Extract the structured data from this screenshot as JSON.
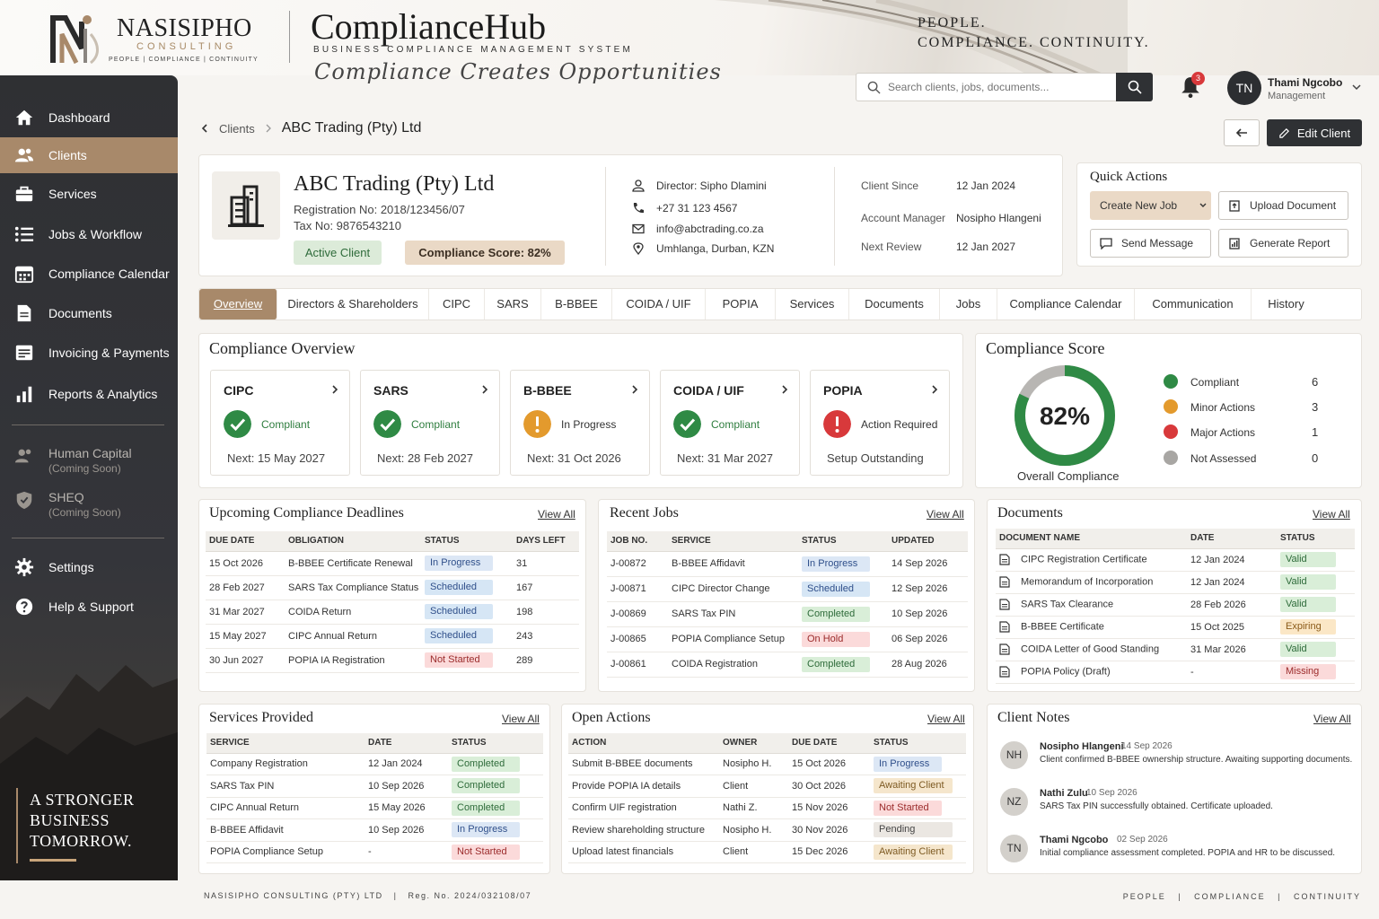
{
  "brand": {
    "name": "NASISIPHO",
    "sub": "CONSULTING",
    "tag": "PEOPLE | COMPLIANCE | CONTINUITY",
    "app_title": "ComplianceHub",
    "app_sub": "BUSINESS COMPLIANCE MANAGEMENT SYSTEM",
    "app_script": "Compliance Creates Opportunities",
    "tagline_1": "PEOPLE.",
    "tagline_2": "COMPLIANCE.  CONTINUITY."
  },
  "search": {
    "placeholder": "Search clients, jobs, documents..."
  },
  "notifications": {
    "count": "3"
  },
  "user": {
    "initials": "TN",
    "name": "Thami Ngcobo",
    "role": "Management"
  },
  "sidebar": {
    "items": [
      {
        "label": "Dashboard",
        "icon": "home-icon"
      },
      {
        "label": "Clients",
        "icon": "users-icon"
      },
      {
        "label": "Services",
        "icon": "briefcase-icon"
      },
      {
        "label": "Jobs & Workflow",
        "icon": "list-icon"
      },
      {
        "label": "Compliance Calendar",
        "icon": "calendar-icon"
      },
      {
        "label": "Documents",
        "icon": "document-icon"
      },
      {
        "label": "Invoicing & Payments",
        "icon": "invoice-icon"
      },
      {
        "label": "Reports & Analytics",
        "icon": "bar-chart-icon"
      }
    ],
    "coming": [
      {
        "label": "Human Capital",
        "note": "(Coming Soon)"
      },
      {
        "label": "SHEQ",
        "note": "(Coming Soon)"
      }
    ],
    "bottom": [
      {
        "label": "Settings",
        "icon": "gear-icon"
      },
      {
        "label": "Help & Support",
        "icon": "help-icon"
      }
    ],
    "quote_1": "A STRONGER",
    "quote_2": "BUSINESS",
    "quote_3": "TOMORROW."
  },
  "breadcrumb": {
    "parent": "Clients",
    "current": "ABC Trading (Pty) Ltd"
  },
  "edit_label": "Edit Client",
  "client": {
    "name": "ABC Trading (Pty) Ltd",
    "registration": "Registration No:  2018/123456/07",
    "tax": "Tax No:  9876543210",
    "status": "Active Client",
    "score_pill": "Compliance Score: 82%",
    "director": "Director: Sipho Dlamini",
    "phone": "+27 31 123 4567",
    "email": "info@abctrading.co.za",
    "address": "Umhlanga, Durban, KZN",
    "since_k": "Client Since",
    "since_v": "12 Jan 2024",
    "manager_k": "Account Manager",
    "manager_v": "Nosipho Hlangeni",
    "review_k": "Next Review",
    "review_v": "12 Jan 2027"
  },
  "quick_actions": {
    "title": "Quick Actions",
    "create": "Create New Job",
    "upload": "Upload Document",
    "message": "Send Message",
    "report": "Generate Report"
  },
  "tabs": [
    "Overview",
    "Directors & Shareholders",
    "CIPC",
    "SARS",
    "B-BBEE",
    "COIDA / UIF",
    "POPIA",
    "Services",
    "Documents",
    "Jobs",
    "Compliance Calendar",
    "Communication",
    "History"
  ],
  "overview": {
    "title": "Compliance Overview",
    "items": [
      {
        "name": "CIPC",
        "status": "Compliant",
        "next": "Next:  15 May 2027",
        "kind": "ok"
      },
      {
        "name": "SARS",
        "status": "Compliant",
        "next": "Next:  28 Feb 2027",
        "kind": "ok"
      },
      {
        "name": "B-BBEE",
        "status": "In Progress",
        "next": "Next:  31 Oct 2026",
        "kind": "warn"
      },
      {
        "name": "COIDA / UIF",
        "status": "Compliant",
        "next": "Next:  31 Mar 2027",
        "kind": "ok"
      },
      {
        "name": "POPIA",
        "status": "Action Required",
        "next": "Setup Outstanding",
        "kind": "err"
      }
    ]
  },
  "score": {
    "title": "Compliance Score",
    "value": "82%",
    "percent": 82,
    "label": "Overall Compliance",
    "legend": [
      {
        "name": "Compliant",
        "value": "6",
        "color": "#2f8a45"
      },
      {
        "name": "Minor Actions",
        "value": "3",
        "color": "#e39a2d"
      },
      {
        "name": "Major Actions",
        "value": "1",
        "color": "#d8393b"
      },
      {
        "name": "Not Assessed",
        "value": "0",
        "color": "#a8a6a3"
      }
    ]
  },
  "deadlines": {
    "title": "Upcoming Compliance Deadlines",
    "view_all": "View All",
    "headers": [
      "DUE DATE",
      "OBLIGATION",
      "STATUS",
      "DAYS LEFT"
    ],
    "rows": [
      [
        "15 Oct 2026",
        "B-BBEE Certificate Renewal",
        "In Progress",
        "31"
      ],
      [
        "28 Feb 2027",
        "SARS Tax Compliance Status",
        "Scheduled",
        "167"
      ],
      [
        "31 Mar 2027",
        "COIDA Return",
        "Scheduled",
        "198"
      ],
      [
        "15 May 2027",
        "CIPC Annual Return",
        "Scheduled",
        "243"
      ],
      [
        "30 Jun 2027",
        "POPIA IA Registration",
        "Not Started",
        "289"
      ]
    ]
  },
  "jobs": {
    "title": "Recent Jobs",
    "view_all": "View All",
    "headers": [
      "JOB NO.",
      "SERVICE",
      "STATUS",
      "UPDATED"
    ],
    "rows": [
      [
        "J-00872",
        "B-BBEE Affidavit",
        "In Progress",
        "14 Sep 2026"
      ],
      [
        "J-00871",
        "CIPC Director Change",
        "Scheduled",
        "12 Sep 2026"
      ],
      [
        "J-00869",
        "SARS Tax PIN",
        "Completed",
        "10 Sep 2026"
      ],
      [
        "J-00865",
        "POPIA Compliance Setup",
        "On Hold",
        "06 Sep 2026"
      ],
      [
        "J-00861",
        "COIDA Registration",
        "Completed",
        "28 Aug 2026"
      ]
    ]
  },
  "documents": {
    "title": "Documents",
    "view_all": "View All",
    "headers": [
      "DOCUMENT NAME",
      "DATE",
      "STATUS"
    ],
    "rows": [
      [
        "CIPC Registration Certificate",
        "12 Jan 2024",
        "Valid"
      ],
      [
        "Memorandum of Incorporation",
        "12 Jan 2024",
        "Valid"
      ],
      [
        "SARS Tax Clearance",
        "28 Feb 2026",
        "Valid"
      ],
      [
        "B-BBEE Certificate",
        "15 Oct 2025",
        "Expiring"
      ],
      [
        "COIDA Letter of Good Standing",
        "31 Mar 2026",
        "Valid"
      ],
      [
        "POPIA Policy (Draft)",
        "-",
        "Missing"
      ]
    ]
  },
  "services": {
    "title": "Services Provided",
    "view_all": "View All",
    "headers": [
      "SERVICE",
      "DATE",
      "STATUS"
    ],
    "rows": [
      [
        "Company Registration",
        "12 Jan 2024",
        "Completed"
      ],
      [
        "SARS Tax PIN",
        "10 Sep 2026",
        "Completed"
      ],
      [
        "CIPC Annual Return",
        "15 May 2026",
        "Completed"
      ],
      [
        "B-BBEE Affidavit",
        "10 Sep 2026",
        "In Progress"
      ],
      [
        "POPIA Compliance Setup",
        "-",
        "Not Started"
      ]
    ]
  },
  "actions": {
    "title": "Open Actions",
    "view_all": "View All",
    "headers": [
      "ACTION",
      "OWNER",
      "DUE DATE",
      "STATUS"
    ],
    "rows": [
      [
        "Submit B-BBEE documents",
        "Nosipho H.",
        "15 Oct 2026",
        "In Progress"
      ],
      [
        "Provide POPIA IA details",
        "Client",
        "30 Oct 2026",
        "Awaiting Client"
      ],
      [
        "Confirm UIF registration",
        "Nathi Z.",
        "15 Nov 2026",
        "Not Started"
      ],
      [
        "Review shareholding structure",
        "Nosipho H.",
        "30 Nov 2026",
        "Pending"
      ],
      [
        "Upload latest financials",
        "Client",
        "15 Dec 2026",
        "Awaiting Client"
      ]
    ]
  },
  "notes": {
    "title": "Client Notes",
    "view_all": "View All",
    "items": [
      {
        "initials": "NH",
        "name": "Nosipho Hlangeni",
        "date": "14 Sep 2026",
        "text": "Client confirmed B-BBEE ownership structure. Awaiting supporting documents."
      },
      {
        "initials": "NZ",
        "name": "Nathi Zulu",
        "date": "10 Sep 2026",
        "text": "SARS Tax PIN successfully obtained. Certificate uploaded."
      },
      {
        "initials": "TN",
        "name": "Thami Ngcobo",
        "date": "02 Sep 2026",
        "text": "Initial compliance assessment completed. POPIA and HR to be discussed."
      }
    ]
  },
  "footer": {
    "left": "NASISIPHO CONSULTING (PTY) LTD   |   Reg. No. 2024/032108/07",
    "right": "PEOPLE   |   COMPLIANCE   |   CONTINUITY"
  }
}
